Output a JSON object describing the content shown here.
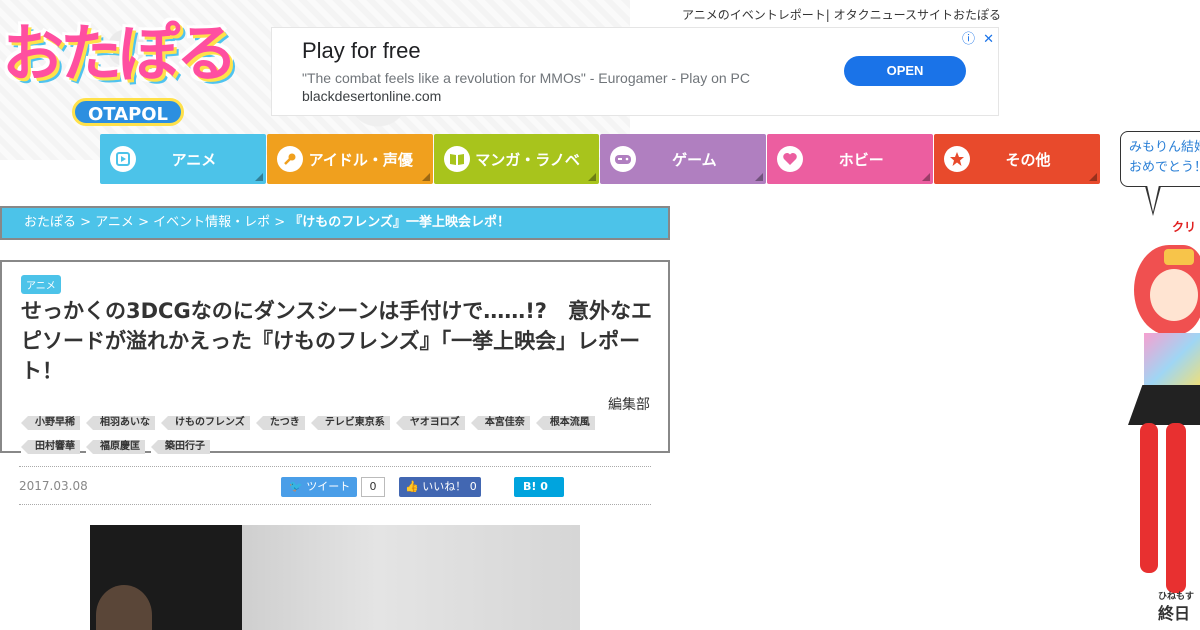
{
  "site": {
    "logo_text": "おたぽる",
    "logo_sub": "OTAPOL",
    "tagline": "アニメのイベントレポート| オタクニュースサイトおたぽる"
  },
  "ad": {
    "title": "Play for free",
    "description": "\"The combat feels like a revolution for MMOs\" - Eurogamer - Play on PC",
    "url": "blackdesertonline.com",
    "cta": "OPEN",
    "info_icon": "ⓘ",
    "close_icon": "✕"
  },
  "nav": {
    "items": [
      {
        "label": "アニメ",
        "icon": "play-icon",
        "color": "#4cc3e9"
      },
      {
        "label": "アイドル・声優",
        "icon": "microphone-icon",
        "color": "#f0a01e"
      },
      {
        "label": "マンガ・ラノベ",
        "icon": "book-icon",
        "color": "#a8c41c"
      },
      {
        "label": "ゲーム",
        "icon": "gamepad-icon",
        "color": "#b07fc0"
      },
      {
        "label": "ホビー",
        "icon": "heart-icon",
        "color": "#ec5ea0"
      },
      {
        "label": "その他",
        "icon": "star-icon",
        "color": "#e84a2c"
      }
    ]
  },
  "breadcrumb": {
    "items": [
      "おたぽる",
      "アニメ",
      "イベント情報・レポ"
    ],
    "separator": " > ",
    "current": "『けものフレンズ』一挙上映会レポ！"
  },
  "article": {
    "category": "アニメ",
    "headline": "せっかくの3DCGなのにダンスシーンは手付けで……!?　意外なエピソードが溢れかえった『けものフレンズ』「一挙上映会」レポート！",
    "author": "編集部",
    "tags": [
      "小野早稀",
      "相羽あいな",
      "けものフレンズ",
      "たつき",
      "テレビ東京系",
      "ヤオヨロズ",
      "本宮佳奈",
      "根本流風",
      "田村響華",
      "福原慶匡",
      "築田行子"
    ],
    "date": "2017.03.08"
  },
  "share": {
    "tweet_label": "ツイート",
    "tweet_count": "0",
    "like_label": "いいね！",
    "like_count": "0",
    "hatena_label": "B!",
    "hatena_count": "0"
  },
  "sidebar": {
    "bubble_text": "みもりん結婚おめでとう！",
    "red_text": "クリ",
    "small_text": "ひねもす",
    "big_text": "終日"
  }
}
